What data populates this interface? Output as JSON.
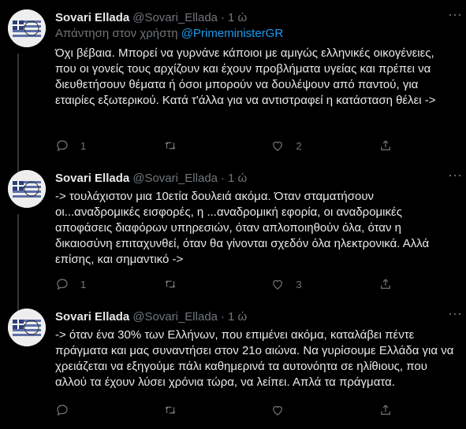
{
  "tweets": [
    {
      "name": "Sovari Ellada",
      "handle": "@Sovari_Ellada",
      "dot": "·",
      "time": "1 ώ",
      "reply_prefix": "Απάντηση στον χρήστη ",
      "reply_mention": "@PrimeministerGR",
      "text": "Όχι βέβαια. Μπορεί να γυρνάνε κάποιοι με αμιγώς ελληνικές οικογένειες, που οι γονείς τους αρχίζουν και έχουν προβλήματα υγείας και πρέπει να διευθετήσουν θέματα ή όσοι μπορούν να δουλέψουν από παντού, για εταιρίες εξωτερικού. Κατά τ'άλλα για να αντιστραφεί η κατάσταση θέλει ->",
      "replies": "1",
      "retweets": "",
      "likes": "2"
    },
    {
      "name": "Sovari Ellada",
      "handle": "@Sovari_Ellada",
      "dot": "·",
      "time": "1 ώ",
      "text": "-> τουλάχιστον μια 10ετία δουλειά ακόμα. Όταν σταματήσουν οι...αναδρομικές εισφορές, η ...αναδρομική εφορία, οι αναδρομικές αποφάσεις διαφόρων υπηρεσιών, όταν απλοποιηθούν όλα, όταν η δικαιοσύνη επιταχυνθεί, όταν θα γίνονται σχεδόν όλα ηλεκτρονικά. Αλλά επίσης, και σημαντικό ->",
      "replies": "1",
      "retweets": "",
      "likes": "3"
    },
    {
      "name": "Sovari Ellada",
      "handle": "@Sovari_Ellada",
      "dot": "·",
      "time": "1 ώ",
      "text": "-> όταν ένα 30% των Ελλήνων, που επιμένει ακόμα, καταλάβει πέντε πράγματα και μας συναντήσει στον 21ο αιώνα. Να γυρίσουμε Ελλάδα για να χρειάζεται να εξηγούμε πάλι καθημερινά τα αυτονόητα σε ηλίθιους, που αλλού τα έχουν λύσει χρόνια τώρα, να λείπει. Απλά τα πράγματα.",
      "replies": "",
      "retweets": "",
      "likes": ""
    }
  ],
  "icons": {
    "reply": "reply-icon",
    "retweet": "retweet-icon",
    "like": "heart-icon",
    "share": "share-icon",
    "more": "more-icon"
  },
  "colors": {
    "background": "#000000",
    "text": "#e7e9ea",
    "secondary": "#71767b",
    "link": "#1d9bf0"
  }
}
